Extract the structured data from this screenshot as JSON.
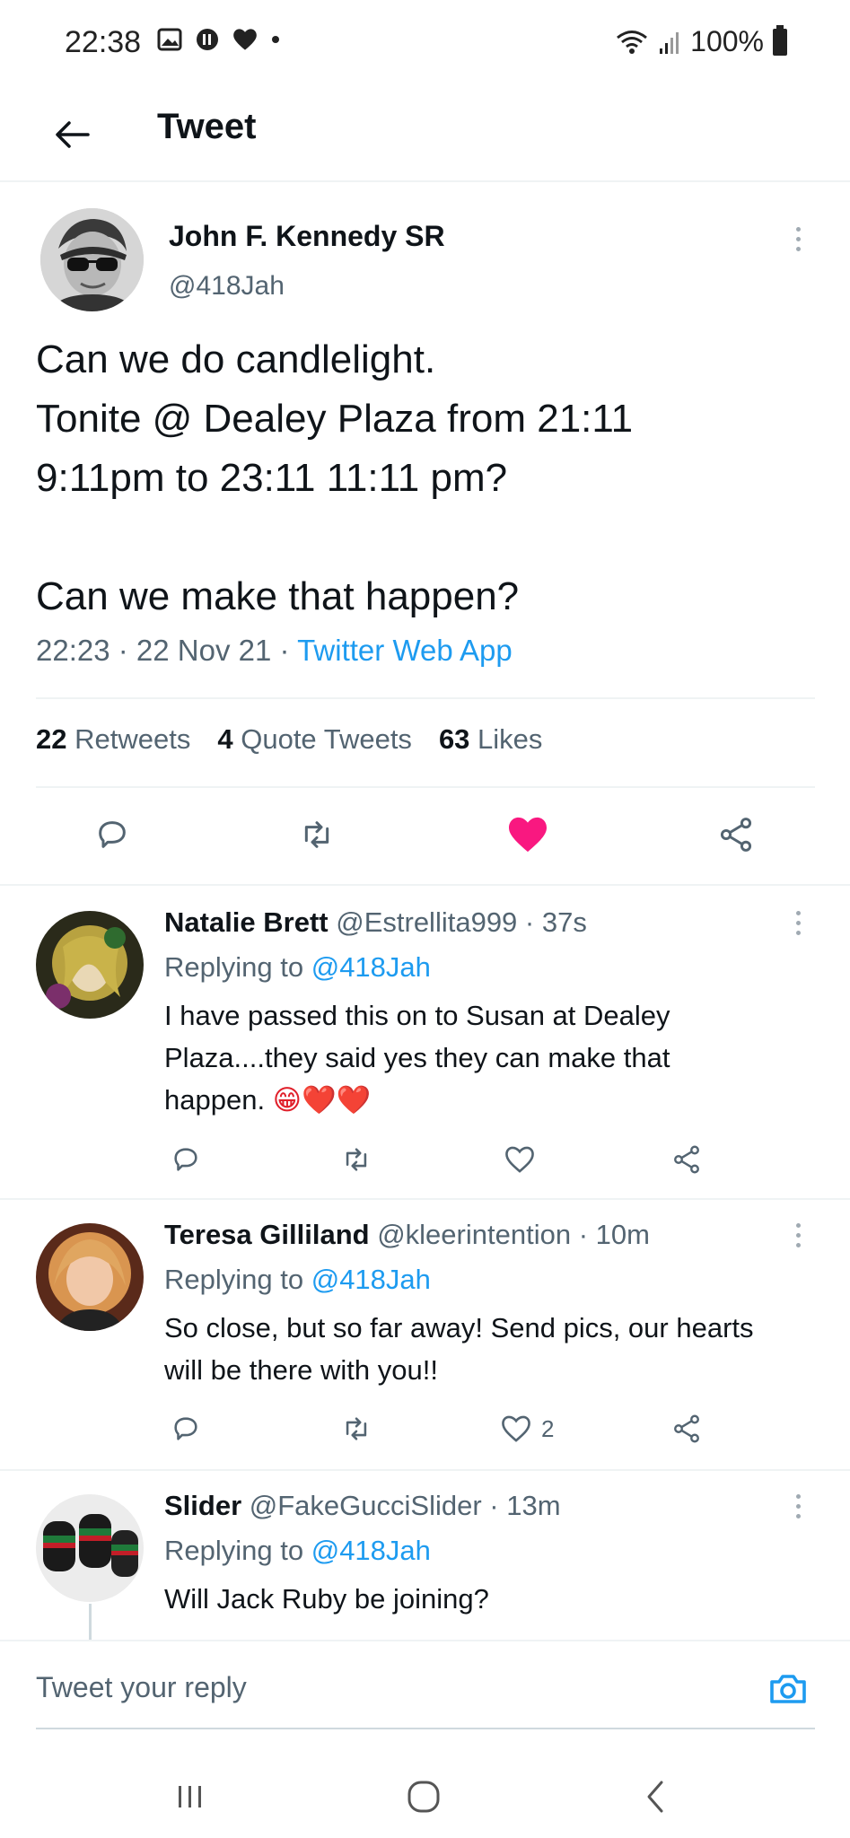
{
  "status_bar": {
    "time": "22:38",
    "battery": "100%",
    "notification_icons": [
      "gallery-icon",
      "media-icon",
      "heart-icon",
      "dot-icon"
    ],
    "right_icons": [
      "wifi-icon",
      "signal-icon",
      "battery-icon"
    ]
  },
  "header": {
    "title": "Tweet"
  },
  "tweet": {
    "author_name": "John F. Kennedy SR",
    "author_handle": "@418Jah",
    "text": "Can we do candlelight.\nTonite @ Dealey Plaza from 21:11\n9:11pm to 23:11 11:11 pm?\n\nCan we make that happen?",
    "time": "22:23",
    "date": "22 Nov 21",
    "source": "Twitter Web App",
    "separator": " · ",
    "retweets_count": "22",
    "retweets_label": "Retweets",
    "quotes_count": "4",
    "quotes_label": "Quote Tweets",
    "likes_count": "63",
    "likes_label": "Likes",
    "liked": true,
    "like_color": "#f91880"
  },
  "replies": [
    {
      "name": "Natalie Brett",
      "handle": "@Estrellita999",
      "age": "37s",
      "replying_prefix": "Replying to",
      "replying_to": "@418Jah",
      "text": "I have passed this on to Susan at Dealey Plaza....they said yes they can make that happen.",
      "emoji": "😁❤️❤️",
      "like_count": ""
    },
    {
      "name": "Teresa Gilliland",
      "handle": "@kleerintention",
      "age": "10m",
      "replying_prefix": "Replying to",
      "replying_to": "@418Jah",
      "text": "So close, but so far away! Send pics, our hearts will be there with you!!",
      "like_count": "2"
    },
    {
      "name": "Slider",
      "handle": "@FakeGucciSlider",
      "age": "13m",
      "replying_prefix": "Replying to",
      "replying_to": "@418Jah",
      "text": "Will Jack Ruby be joining?"
    }
  ],
  "compose": {
    "placeholder": "Tweet your reply"
  },
  "colors": {
    "accent": "#1d9bf0",
    "like": "#f91880",
    "muted_text": "#536471"
  }
}
